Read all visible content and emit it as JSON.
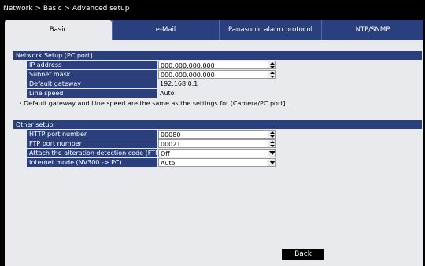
{
  "breadcrumb": "Network > Basic > Advanced setup",
  "tabs": [
    {
      "label": "Basic"
    },
    {
      "label": "e-Mail"
    },
    {
      "label": "Panasonic alarm protocol"
    },
    {
      "label": "NTP/SNMP"
    }
  ],
  "network_section": {
    "title": "Network Setup [PC port]",
    "rows": [
      {
        "label": "IP address",
        "value": "000.000.000.000",
        "control": "spinner"
      },
      {
        "label": "Subnet mask",
        "value": "000.000.000.000",
        "control": "spinner"
      },
      {
        "label": "Default gateway",
        "value": "192.168.0.1",
        "control": "readonly"
      },
      {
        "label": "Line speed",
        "value": "Auto",
        "control": "readonly"
      }
    ],
    "note": "・Default gateway and Line speed are the same as the settings for [Camera/PC port]."
  },
  "other_section": {
    "title": "Other setup",
    "rows": [
      {
        "label": "HTTP port number",
        "value": "00080",
        "control": "spinner"
      },
      {
        "label": "FTP port number",
        "value": "00021",
        "control": "spinner"
      },
      {
        "label": "Attach the alteration detection code (FTP)",
        "value": "Off",
        "control": "dropdown"
      },
      {
        "label": "Internet mode (NV300 -> PC)",
        "value": "Auto",
        "control": "dropdown"
      }
    ]
  },
  "buttons": {
    "back": "Back"
  },
  "colors": {
    "header_blue": "#2a3f7e",
    "panel_bg": "#e9eaee",
    "background": "#000000"
  }
}
